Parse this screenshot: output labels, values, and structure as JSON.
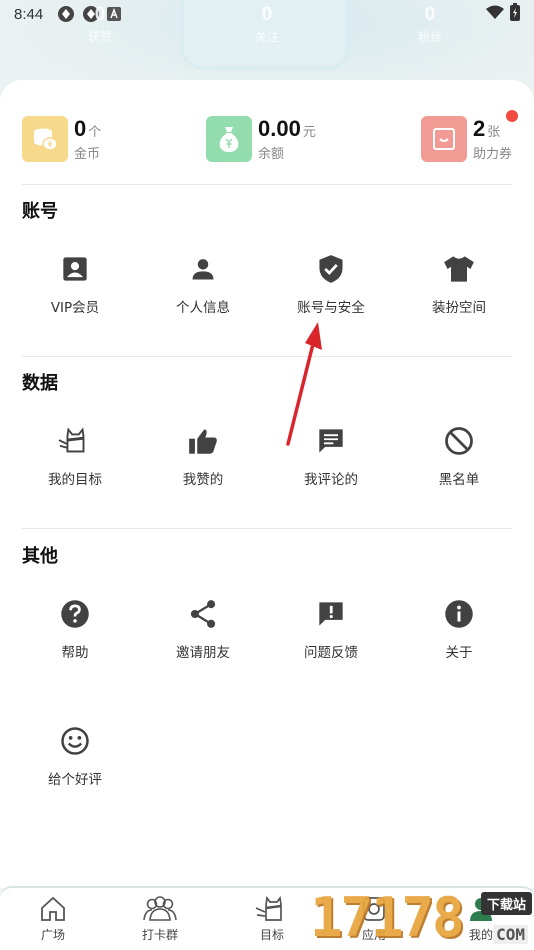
{
  "status_bar": {
    "time": "8:44",
    "icons": [
      "app-icon-1",
      "app-icon-2",
      "app-icon-a",
      "wifi-icon",
      "battery-icon"
    ]
  },
  "top_stats": [
    {
      "value": "0",
      "label": "获赞"
    },
    {
      "value": "0",
      "label": "关注"
    },
    {
      "value": "0",
      "label": "粉丝"
    }
  ],
  "wallet": {
    "coins": {
      "value": "0",
      "unit": "个",
      "label": "金币",
      "icon": "coin-stack-icon",
      "color": "#f7d98c"
    },
    "balance": {
      "value": "0.00",
      "unit": "元",
      "label": "余额",
      "icon": "money-bag-icon",
      "color": "#93dcad"
    },
    "vouchers": {
      "value": "2",
      "unit": "张",
      "label": "助力券",
      "icon": "voucher-icon",
      "color": "#f29a94"
    }
  },
  "sections": {
    "account": {
      "title": "账号",
      "items": [
        {
          "label": "VIP会员",
          "icon": "vip-card-icon"
        },
        {
          "label": "个人信息",
          "icon": "person-icon"
        },
        {
          "label": "账号与安全",
          "icon": "shield-check-icon"
        },
        {
          "label": "装扮空间",
          "icon": "tshirt-icon"
        }
      ]
    },
    "data": {
      "title": "数据",
      "items": [
        {
          "label": "我的目标",
          "icon": "target-cat-icon"
        },
        {
          "label": "我赞的",
          "icon": "thumbs-up-icon"
        },
        {
          "label": "我评论的",
          "icon": "comment-icon"
        },
        {
          "label": "黑名单",
          "icon": "block-icon"
        }
      ]
    },
    "other": {
      "title": "其他",
      "items": [
        {
          "label": "帮助",
          "icon": "help-icon"
        },
        {
          "label": "邀请朋友",
          "icon": "share-icon"
        },
        {
          "label": "问题反馈",
          "icon": "feedback-icon"
        },
        {
          "label": "关于",
          "icon": "info-icon"
        },
        {
          "label": "给个好评",
          "icon": "smile-icon"
        }
      ]
    }
  },
  "bottom_nav": [
    {
      "label": "广场",
      "icon": "home-icon"
    },
    {
      "label": "打卡群",
      "icon": "group-icon"
    },
    {
      "label": "目标",
      "icon": "target-cat-icon"
    },
    {
      "label": "应用",
      "icon": "apps-icon"
    },
    {
      "label": "我的",
      "icon": "profile-icon"
    }
  ],
  "watermark": {
    "digits": "17178",
    "badge": "下载站",
    "suffix": "COM"
  }
}
